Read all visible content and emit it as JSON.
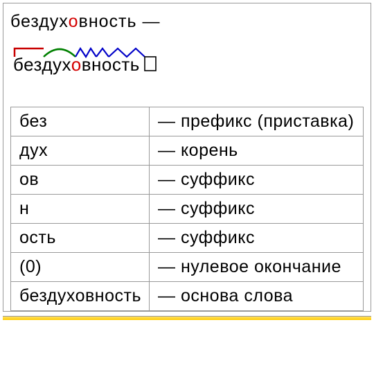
{
  "headline": {
    "pre": "бездух",
    "accent": "о",
    "post": "вность",
    "dash": "—"
  },
  "morphemes": {
    "pre": "бездух",
    "accent": "о",
    "post": "вность"
  },
  "diagram": {
    "prefix_color": "#c80000",
    "root_color": "#008000",
    "suffix_color": "#0000c8",
    "ending_color": "#000000"
  },
  "table": {
    "rows": [
      {
        "morph": "без",
        "desc": "— префикс (приставка)"
      },
      {
        "morph": "дух",
        "desc": "— корень"
      },
      {
        "morph": "ов",
        "desc": "— суффикс"
      },
      {
        "morph": "н",
        "desc": "— суффикс"
      },
      {
        "morph": "ость",
        "desc": "— суффикс"
      },
      {
        "morph": "(0)",
        "desc": "— нулевое окончание"
      },
      {
        "morph": "бездуховность",
        "desc": "— основа слова"
      }
    ]
  }
}
